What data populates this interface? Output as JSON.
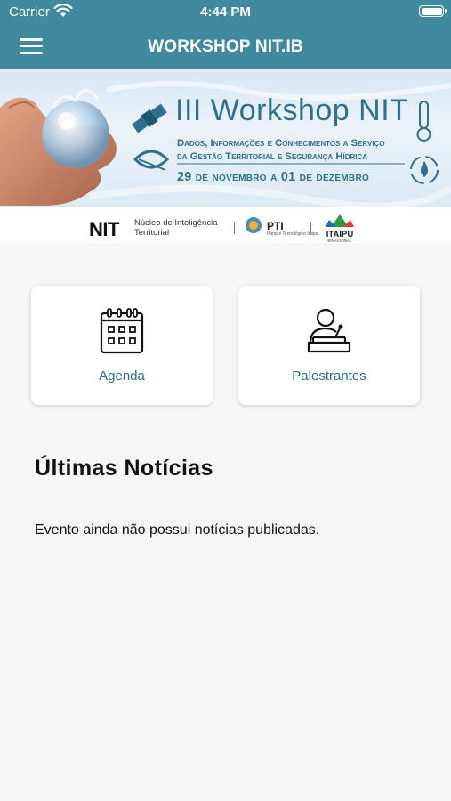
{
  "status_bar": {
    "carrier": "Carrier",
    "time": "4:44 PM"
  },
  "header": {
    "title": "WORKSHOP NIT.IB",
    "menu_icon": "hamburger-menu-icon"
  },
  "banner": {
    "title": "III Workshop NIT",
    "subtitle_line1": "Dados, Informações e Conhecimentos a Serviço",
    "subtitle_line2": "da Gestão Territorial e Segurança Hídrica",
    "dates": "29 de novembro a 01 de dezembro"
  },
  "partners": {
    "nit": "NIT",
    "nit_desc_line1": "Núcleo de Inteligência",
    "nit_desc_line2": "Territorial",
    "pti": "PTI",
    "pti_desc": "Parque Tecnológico Itaipu",
    "itaipu": "ITAIPU",
    "itaipu_desc": "BINACIONAL"
  },
  "cards": [
    {
      "label": "Agenda",
      "icon": "calendar-icon"
    },
    {
      "label": "Palestrantes",
      "icon": "speaker-podium-icon"
    }
  ],
  "news": {
    "title": "Últimas Notícias",
    "empty_message": "Evento ainda não possui notícias publicadas."
  },
  "colors": {
    "header_bg": "#3f8a9e",
    "accent_text": "#2b6e86",
    "page_bg": "#f4f6fa"
  }
}
